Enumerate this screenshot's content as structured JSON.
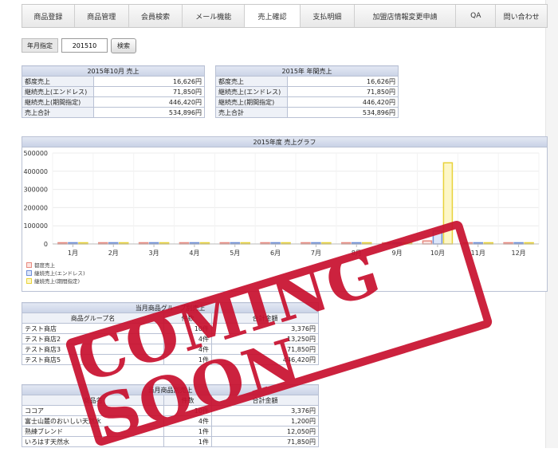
{
  "nav": {
    "tabs": [
      "商品登録",
      "商品管理",
      "会員検索",
      "メール機能",
      "売上確認",
      "支払明細",
      "加盟店情報変更申請",
      "QA",
      "問い合わせ"
    ],
    "active": "売上確認"
  },
  "search": {
    "label": "年月指定",
    "value": "201510",
    "button": "検索"
  },
  "monthly": {
    "title": "2015年10月 売上",
    "rows": [
      {
        "k": "都度売上",
        "v": "16,626円"
      },
      {
        "k": "継続売上(エンドレス)",
        "v": "71,850円"
      },
      {
        "k": "継続売上(期間指定)",
        "v": "446,420円"
      },
      {
        "k": "売上合計",
        "v": "534,896円"
      }
    ]
  },
  "yearly": {
    "title": "2015年 年間売上",
    "rows": [
      {
        "k": "都度売上",
        "v": "16,626円"
      },
      {
        "k": "継続売上(エンドレス)",
        "v": "71,850円"
      },
      {
        "k": "継続売上(期間指定)",
        "v": "446,420円"
      },
      {
        "k": "売上合計",
        "v": "534,896円"
      }
    ]
  },
  "chart_data": {
    "type": "bar",
    "title": "2015年度 売上グラフ",
    "categories": [
      "1月",
      "2月",
      "3月",
      "4月",
      "5月",
      "6月",
      "7月",
      "8月",
      "9月",
      "10月",
      "11月",
      "12月"
    ],
    "series": [
      {
        "name": "都度売上",
        "values": [
          0,
          0,
          0,
          0,
          0,
          0,
          0,
          0,
          0,
          16626,
          0,
          0
        ],
        "color": "#e88a80",
        "fill": "#fbe3e0"
      },
      {
        "name": "継続売上(エンドレス)",
        "values": [
          0,
          0,
          0,
          0,
          0,
          0,
          0,
          0,
          0,
          71850,
          0,
          0
        ],
        "color": "#6f8fd8",
        "fill": "#dde6fa"
      },
      {
        "name": "継続売上(期間指定)",
        "values": [
          0,
          0,
          0,
          0,
          0,
          0,
          0,
          0,
          0,
          446420,
          0,
          0
        ],
        "color": "#e8d23a",
        "fill": "#fdf7c7"
      }
    ],
    "yticks": [
      "0",
      "100000",
      "200000",
      "300000",
      "400000",
      "500000"
    ],
    "ylim": [
      0,
      500000
    ],
    "grid": true,
    "legend": "bottom-left"
  },
  "group": {
    "title": "当月商品グループ別売上",
    "headers": [
      "商品グループ名",
      "件数",
      "合計金額"
    ],
    "rows": [
      {
        "name": "テスト商店",
        "count": "10件",
        "total": "3,376円"
      },
      {
        "name": "テスト商店2",
        "count": "4件",
        "total": "13,250円"
      },
      {
        "name": "テスト商店3",
        "count": "4件",
        "total": "71,850円"
      },
      {
        "name": "テスト商店5",
        "count": "1件",
        "total": "446,420円"
      }
    ]
  },
  "product": {
    "title": "当月商品別売上",
    "headers": [
      "商品名",
      "件数",
      "合計金額"
    ],
    "rows": [
      {
        "name": "ココア",
        "count": "10件",
        "total": "3,376円"
      },
      {
        "name": "富士山麓のおいしい天然水",
        "count": "4件",
        "total": "1,200円"
      },
      {
        "name": "熟練ブレンド",
        "count": "1件",
        "total": "12,050円"
      },
      {
        "name": "いろはす天然水",
        "count": "1件",
        "total": "71,850円"
      }
    ]
  },
  "stamp": {
    "text": "COMING SOON"
  }
}
